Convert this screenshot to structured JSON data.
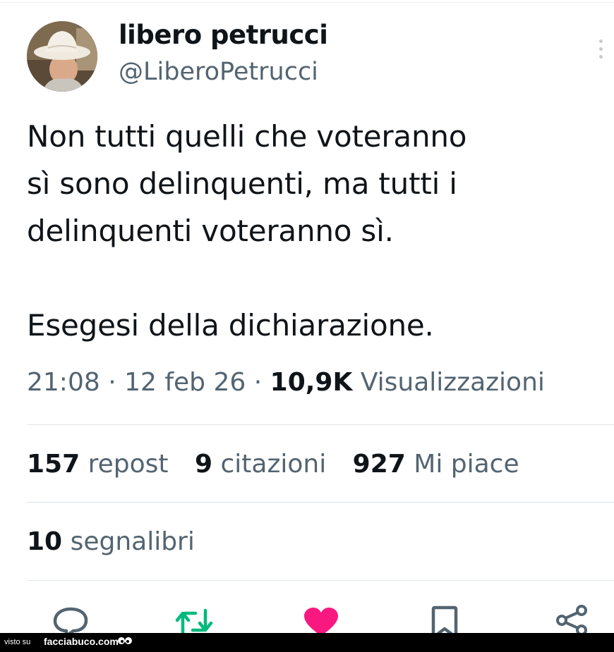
{
  "tweet": {
    "display_name": "libero petrucci",
    "handle": "@LiberoPetrucci",
    "text_lines": [
      "Non tutti quelli che voteranno",
      "sì sono delinquenti, ma tutti i",
      "delinquenti voteranno sì."
    ],
    "text_lines_2": [
      "Esegesi della dichiarazione."
    ],
    "time": "21:08",
    "date": "12 feb 26",
    "views_count": "10,9K",
    "views_label": "Visualizzazioni",
    "separator": "·"
  },
  "stats": {
    "reposts_count": "157",
    "reposts_label": "repost",
    "quotes_count": "9",
    "quotes_label": "citazioni",
    "likes_count": "927",
    "likes_label": "Mi piace",
    "bookmarks_count": "10",
    "bookmarks_label": "segnalibri"
  },
  "actions": {
    "reply_icon": "reply-icon",
    "repost_icon": "repost-icon",
    "like_icon": "heart-icon",
    "bookmark_icon": "bookmark-icon",
    "share_icon": "share-icon"
  },
  "colors": {
    "repost_green": "#00ba7c",
    "like_pink": "#f91880",
    "secondary_text": "#536471"
  },
  "watermark": {
    "prefix": "visto su",
    "brand": "facciabuco.com"
  }
}
